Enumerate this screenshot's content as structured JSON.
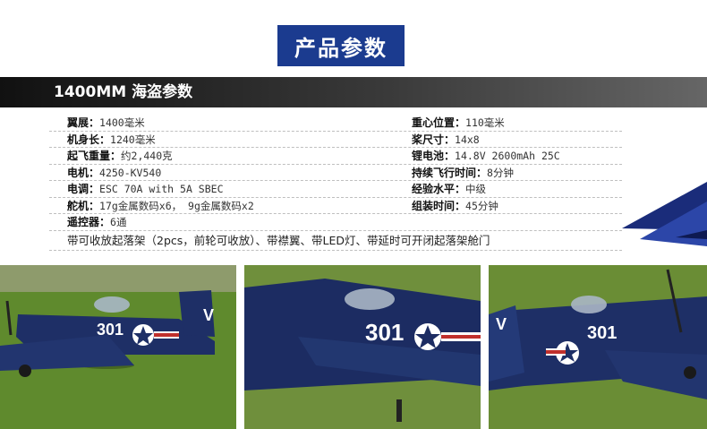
{
  "badge": {
    "title": "产品参数"
  },
  "header": {
    "title": "1400MM 海盗参数"
  },
  "specs": {
    "rows": [
      {
        "left": {
          "label": "翼展：",
          "value": "1400毫米"
        },
        "right": {
          "label": "重心位置：",
          "value": "110毫米"
        }
      },
      {
        "left": {
          "label": "机身长：",
          "value": "1240毫米"
        },
        "right": {
          "label": "桨尺寸：",
          "value": "14x8"
        }
      },
      {
        "left": {
          "label": "起飞重量：",
          "value": "约2,440克"
        },
        "right": {
          "label": "锂电池：",
          "value": "14.8V 2600mAh 25C"
        }
      },
      {
        "left": {
          "label": "电机：",
          "value": "4250-KV540"
        },
        "right": {
          "label": "持续飞行时间：",
          "value": "8分钟"
        }
      },
      {
        "left": {
          "label": "电调：",
          "value": "ESC 70A with 5A SBEC"
        },
        "right": {
          "label": "经验水平：",
          "value": "中级"
        }
      },
      {
        "left": {
          "label": "舵机：",
          "value": "17g金属数码x6，  9g金属数码x2"
        },
        "right": {
          "label": "组装时间：",
          "value": "45分钟"
        }
      },
      {
        "left": {
          "label": "遥控器：",
          "value": "6通"
        },
        "right": {
          "label": "",
          "value": ""
        }
      }
    ],
    "note": "带可收放起落架（2pcs，前轮可收放）、带襟翼、带LED灯、带延时可开闭起落架舱门"
  },
  "photos": {
    "markings": [
      "301",
      "301",
      "301"
    ],
    "tail_letter": "V"
  },
  "colors": {
    "badge": "#1b3b8f",
    "aircraft": "#1e2f66",
    "grass": "#5e8a2e"
  }
}
